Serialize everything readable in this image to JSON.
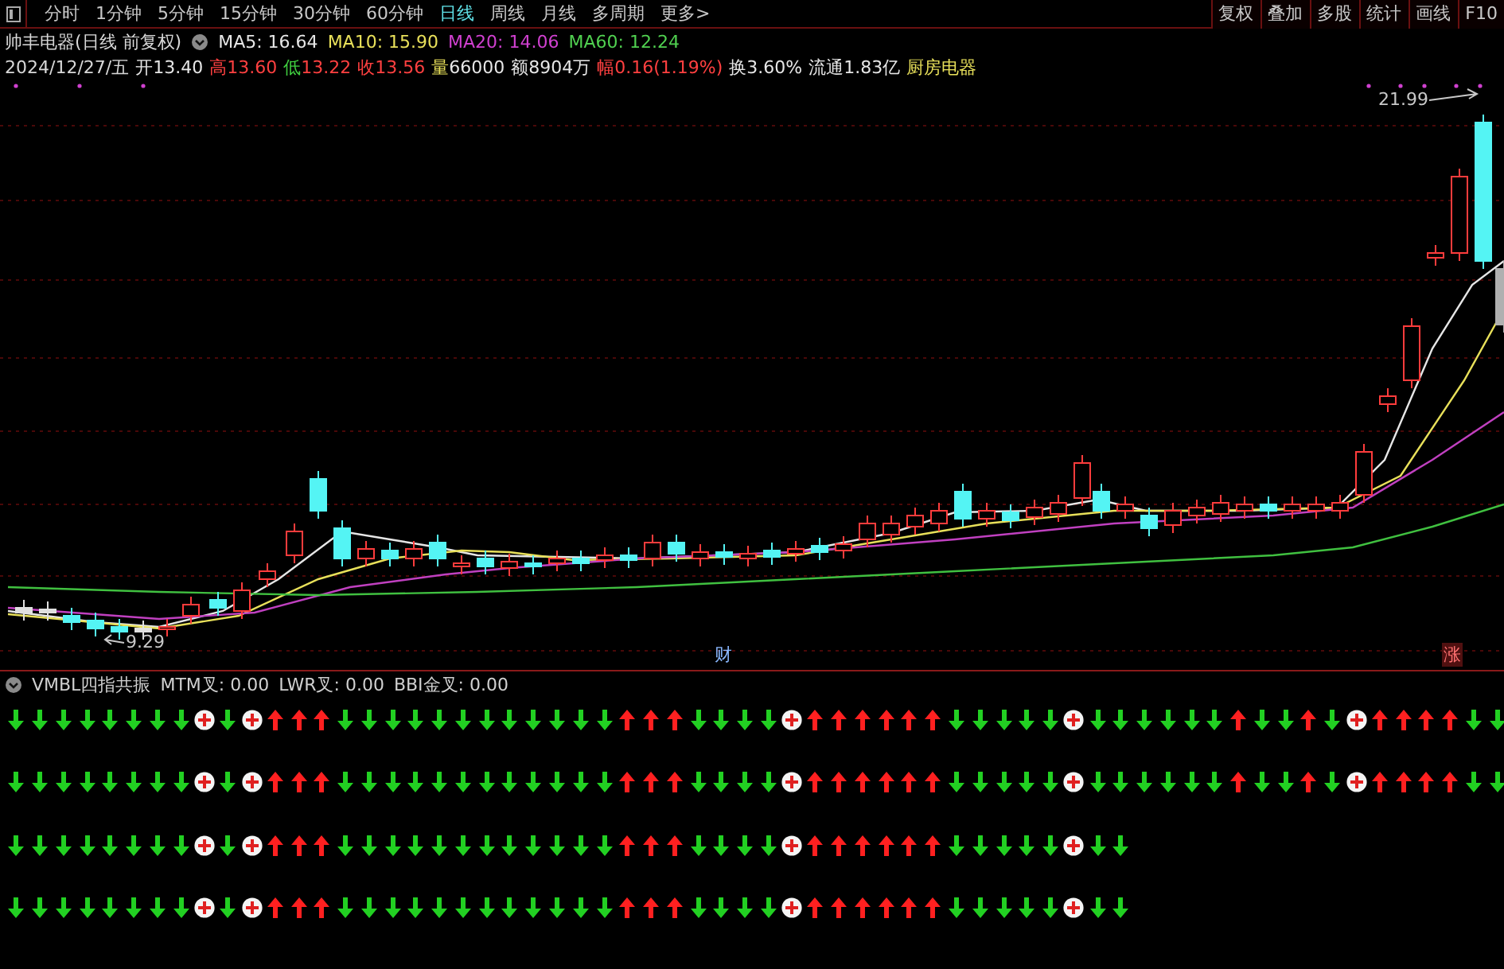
{
  "toolbar": {
    "tabs": [
      {
        "label": "分时",
        "selected": false
      },
      {
        "label": "1分钟",
        "selected": false
      },
      {
        "label": "5分钟",
        "selected": false
      },
      {
        "label": "15分钟",
        "selected": false
      },
      {
        "label": "30分钟",
        "selected": false
      },
      {
        "label": "60分钟",
        "selected": false
      },
      {
        "label": "日线",
        "selected": true
      },
      {
        "label": "周线",
        "selected": false
      },
      {
        "label": "月线",
        "selected": false
      },
      {
        "label": "多周期",
        "selected": false
      },
      {
        "label": "更多>",
        "selected": false
      }
    ],
    "buttons": [
      "复权",
      "叠加",
      "多股",
      "统计",
      "画线",
      "F10"
    ]
  },
  "quote_header": {
    "title": "帅丰电器(日线 前复权)",
    "averages": [
      {
        "label": "MA5: 16.64",
        "color": "#e6e6e6"
      },
      {
        "label": "MA10: 15.90",
        "color": "#e8e05a"
      },
      {
        "label": "MA20: 14.06",
        "color": "#d040d0"
      },
      {
        "label": "MA60: 12.24",
        "color": "#50d050"
      }
    ]
  },
  "quote_line": {
    "date": "2024/12/27/五",
    "fields": [
      {
        "label": {
          "text": "开",
          "color": "#e6e6e6"
        },
        "value": {
          "text": "13.40",
          "color": "#e6e6e6"
        }
      },
      {
        "label": {
          "text": "高",
          "color": "#ff4040"
        },
        "value": {
          "text": "13.60",
          "color": "#ff4040"
        }
      },
      {
        "label": {
          "text": "低",
          "color": "#40d040"
        },
        "value": {
          "text": "13.22",
          "color": "#ff4040"
        }
      },
      {
        "label": {
          "text": "收",
          "color": "#ff4040"
        },
        "value": {
          "text": "13.56",
          "color": "#ff4040"
        }
      },
      {
        "label": {
          "text": "量",
          "color": "#e8e05a"
        },
        "value": {
          "text": "66000",
          "color": "#e6e6e6"
        }
      },
      {
        "label": {
          "text": "额",
          "color": "#e6e6e6"
        },
        "value": {
          "text": "8904万",
          "color": "#e6e6e6"
        }
      },
      {
        "label": {
          "text": "幅",
          "color": "#ff4040"
        },
        "value": {
          "text": "0.16(1.19%)",
          "color": "#ff4040"
        }
      },
      {
        "label": {
          "text": "换",
          "color": "#e6e6e6"
        },
        "value": {
          "text": "3.60%",
          "color": "#e6e6e6"
        }
      },
      {
        "label": {
          "text": "流通",
          "color": "#e6e6e6"
        },
        "value": {
          "text": "1.83亿",
          "color": "#e6e6e6"
        }
      }
    ],
    "industry": "厨房电器"
  },
  "price_chart": {
    "high_label": "21.99",
    "low_label": "9.29",
    "event_markers": [
      {
        "label": "财",
        "kind": "finance"
      },
      {
        "label": "涨",
        "kind": "limit"
      }
    ]
  },
  "indicator": {
    "name": "VMBL四指共振",
    "values": [
      "MTM叉: 0.00",
      "LWR叉: 0.00",
      "BBI金叉: 0.00"
    ],
    "signal_rows": [
      [
        {
          "kind": "down"
        },
        {
          "kind": "down"
        },
        {
          "kind": "down"
        },
        {
          "kind": "down"
        },
        {
          "kind": "down"
        },
        {
          "kind": "down"
        },
        {
          "kind": "down"
        },
        {
          "kind": "down"
        },
        {
          "kind": "plus"
        },
        {
          "kind": "down"
        },
        {
          "kind": "plus"
        },
        {
          "kind": "up"
        },
        {
          "kind": "up"
        },
        {
          "kind": "up"
        },
        {
          "kind": "down"
        },
        {
          "kind": "down"
        },
        {
          "kind": "down"
        },
        {
          "kind": "down"
        },
        {
          "kind": "down"
        },
        {
          "kind": "down"
        },
        {
          "kind": "down"
        },
        {
          "kind": "down"
        },
        {
          "kind": "down"
        },
        {
          "kind": "down"
        },
        {
          "kind": "down"
        },
        {
          "kind": "down"
        },
        {
          "kind": "up"
        },
        {
          "kind": "up"
        },
        {
          "kind": "up"
        },
        {
          "kind": "down"
        },
        {
          "kind": "down"
        },
        {
          "kind": "down"
        },
        {
          "kind": "down"
        },
        {
          "kind": "plus"
        },
        {
          "kind": "up"
        },
        {
          "kind": "up"
        },
        {
          "kind": "up"
        },
        {
          "kind": "up"
        },
        {
          "kind": "up"
        },
        {
          "kind": "up"
        },
        {
          "kind": "down"
        },
        {
          "kind": "down"
        },
        {
          "kind": "down"
        },
        {
          "kind": "down"
        },
        {
          "kind": "down"
        },
        {
          "kind": "plus"
        },
        {
          "kind": "down"
        },
        {
          "kind": "down"
        },
        {
          "kind": "down"
        },
        {
          "kind": "down"
        },
        {
          "kind": "down"
        },
        {
          "kind": "down"
        },
        {
          "kind": "up"
        },
        {
          "kind": "down"
        },
        {
          "kind": "down"
        },
        {
          "kind": "up"
        },
        {
          "kind": "down"
        },
        {
          "kind": "plus"
        },
        {
          "kind": "up"
        },
        {
          "kind": "up"
        },
        {
          "kind": "up"
        },
        {
          "kind": "up"
        },
        {
          "kind": "down"
        },
        {
          "kind": "down"
        }
      ],
      [
        {
          "kind": "down"
        },
        {
          "kind": "down"
        },
        {
          "kind": "down"
        },
        {
          "kind": "down"
        },
        {
          "kind": "down"
        },
        {
          "kind": "down"
        },
        {
          "kind": "down"
        },
        {
          "kind": "down"
        },
        {
          "kind": "plus"
        },
        {
          "kind": "down"
        },
        {
          "kind": "plus"
        },
        {
          "kind": "up"
        },
        {
          "kind": "up"
        },
        {
          "kind": "up"
        },
        {
          "kind": "down"
        },
        {
          "kind": "down"
        },
        {
          "kind": "down"
        },
        {
          "kind": "down"
        },
        {
          "kind": "down"
        },
        {
          "kind": "down"
        },
        {
          "kind": "down"
        },
        {
          "kind": "down"
        },
        {
          "kind": "down"
        },
        {
          "kind": "down"
        },
        {
          "kind": "down"
        },
        {
          "kind": "down"
        },
        {
          "kind": "up"
        },
        {
          "kind": "up"
        },
        {
          "kind": "up"
        },
        {
          "kind": "down"
        },
        {
          "kind": "down"
        },
        {
          "kind": "down"
        },
        {
          "kind": "down"
        },
        {
          "kind": "plus"
        },
        {
          "kind": "up"
        },
        {
          "kind": "up"
        },
        {
          "kind": "up"
        },
        {
          "kind": "up"
        },
        {
          "kind": "up"
        },
        {
          "kind": "up"
        },
        {
          "kind": "down"
        },
        {
          "kind": "down"
        },
        {
          "kind": "down"
        },
        {
          "kind": "down"
        },
        {
          "kind": "down"
        },
        {
          "kind": "plus"
        },
        {
          "kind": "down"
        },
        {
          "kind": "down"
        },
        {
          "kind": "down"
        },
        {
          "kind": "down"
        },
        {
          "kind": "down"
        },
        {
          "kind": "down"
        },
        {
          "kind": "up"
        },
        {
          "kind": "down"
        },
        {
          "kind": "down"
        },
        {
          "kind": "up"
        },
        {
          "kind": "down"
        },
        {
          "kind": "plus"
        },
        {
          "kind": "up"
        },
        {
          "kind": "up"
        },
        {
          "kind": "up"
        },
        {
          "kind": "up"
        },
        {
          "kind": "down"
        },
        {
          "kind": "down"
        }
      ],
      [
        {
          "kind": "down"
        },
        {
          "kind": "down"
        },
        {
          "kind": "down"
        },
        {
          "kind": "down"
        },
        {
          "kind": "down"
        },
        {
          "kind": "down"
        },
        {
          "kind": "down"
        },
        {
          "kind": "down"
        },
        {
          "kind": "plus"
        },
        {
          "kind": "down"
        },
        {
          "kind": "plus"
        },
        {
          "kind": "up"
        },
        {
          "kind": "up"
        },
        {
          "kind": "up"
        },
        {
          "kind": "down"
        },
        {
          "kind": "down"
        },
        {
          "kind": "down"
        },
        {
          "kind": "down"
        },
        {
          "kind": "down"
        },
        {
          "kind": "down"
        },
        {
          "kind": "down"
        },
        {
          "kind": "down"
        },
        {
          "kind": "down"
        },
        {
          "kind": "down"
        },
        {
          "kind": "down"
        },
        {
          "kind": "down"
        },
        {
          "kind": "up"
        },
        {
          "kind": "up"
        },
        {
          "kind": "up"
        },
        {
          "kind": "down"
        },
        {
          "kind": "down"
        },
        {
          "kind": "down"
        },
        {
          "kind": "down"
        },
        {
          "kind": "plus"
        },
        {
          "kind": "up"
        },
        {
          "kind": "up"
        },
        {
          "kind": "up"
        },
        {
          "kind": "up"
        },
        {
          "kind": "up"
        },
        {
          "kind": "up"
        },
        {
          "kind": "down"
        },
        {
          "kind": "down"
        },
        {
          "kind": "down"
        },
        {
          "kind": "down"
        },
        {
          "kind": "down"
        },
        {
          "kind": "plus"
        },
        {
          "kind": "down"
        },
        {
          "kind": "down"
        }
      ],
      [
        {
          "kind": "down"
        },
        {
          "kind": "down"
        },
        {
          "kind": "down"
        },
        {
          "kind": "down"
        },
        {
          "kind": "down"
        },
        {
          "kind": "down"
        },
        {
          "kind": "down"
        },
        {
          "kind": "down"
        },
        {
          "kind": "plus"
        },
        {
          "kind": "down"
        },
        {
          "kind": "plus"
        },
        {
          "kind": "up"
        },
        {
          "kind": "up"
        },
        {
          "kind": "up"
        },
        {
          "kind": "down"
        },
        {
          "kind": "down"
        },
        {
          "kind": "down"
        },
        {
          "kind": "down"
        },
        {
          "kind": "down"
        },
        {
          "kind": "down"
        },
        {
          "kind": "down"
        },
        {
          "kind": "down"
        },
        {
          "kind": "down"
        },
        {
          "kind": "down"
        },
        {
          "kind": "down"
        },
        {
          "kind": "down"
        },
        {
          "kind": "up"
        },
        {
          "kind": "up"
        },
        {
          "kind": "up"
        },
        {
          "kind": "down"
        },
        {
          "kind": "down"
        },
        {
          "kind": "down"
        },
        {
          "kind": "down"
        },
        {
          "kind": "plus"
        },
        {
          "kind": "up"
        },
        {
          "kind": "up"
        },
        {
          "kind": "up"
        },
        {
          "kind": "up"
        },
        {
          "kind": "up"
        },
        {
          "kind": "up"
        },
        {
          "kind": "down"
        },
        {
          "kind": "down"
        },
        {
          "kind": "down"
        },
        {
          "kind": "down"
        },
        {
          "kind": "down"
        },
        {
          "kind": "plus"
        },
        {
          "kind": "down"
        },
        {
          "kind": "down"
        }
      ]
    ]
  }
}
